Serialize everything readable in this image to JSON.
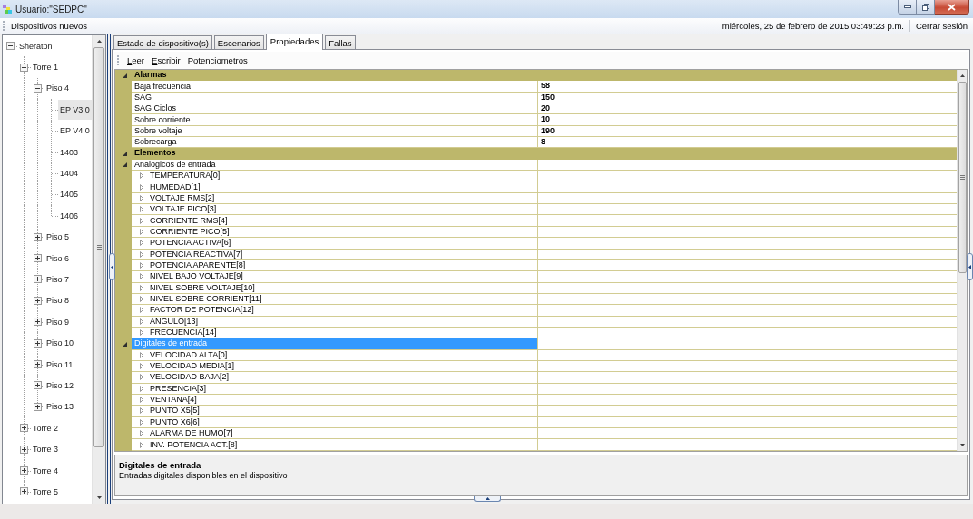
{
  "window": {
    "title": "Usuario:\"SEDPC\""
  },
  "menu_bar": {
    "items": [
      {
        "label": "Dispositivos nuevos"
      }
    ],
    "datetime": "miércoles, 25 de febrero de 2015 03:49:23 p.m.",
    "logout": "Cerrar sesión"
  },
  "tree": [
    {
      "label": "Sheraton",
      "expanded": true,
      "selected": false,
      "children": [
        {
          "label": "Torre 1",
          "expanded": true,
          "selected": false,
          "children": [
            {
              "label": "Piso 4",
              "expanded": true,
              "selected": false,
              "children": [
                {
                  "label": "EP V3.0",
                  "selected": true
                },
                {
                  "label": "EP V4.0",
                  "selected": false
                },
                {
                  "label": "1403",
                  "selected": false
                },
                {
                  "label": "1404",
                  "selected": false
                },
                {
                  "label": "1405",
                  "selected": false
                },
                {
                  "label": "1406",
                  "selected": false
                }
              ]
            },
            {
              "label": "Piso 5",
              "expanded": false,
              "selected": false
            },
            {
              "label": "Piso 6",
              "expanded": false,
              "selected": false
            },
            {
              "label": "Piso 7",
              "expanded": false,
              "selected": false
            },
            {
              "label": "Piso 8",
              "expanded": false,
              "selected": false
            },
            {
              "label": "Piso 9",
              "expanded": false,
              "selected": false
            },
            {
              "label": "Piso 10",
              "expanded": false,
              "selected": false
            },
            {
              "label": "Piso 11",
              "expanded": false,
              "selected": false
            },
            {
              "label": "Piso 12",
              "expanded": false,
              "selected": false
            },
            {
              "label": "Piso 13",
              "expanded": false,
              "selected": false
            }
          ]
        },
        {
          "label": "Torre 2",
          "expanded": false,
          "selected": false
        },
        {
          "label": "Torre 3",
          "expanded": false,
          "selected": false
        },
        {
          "label": "Torre 4",
          "expanded": false,
          "selected": false
        },
        {
          "label": "Torre 5",
          "expanded": false,
          "selected": false
        }
      ]
    }
  ],
  "tabs": [
    {
      "label": "Estado de dispositivo(s)",
      "selected": false
    },
    {
      "label": "Escenarios",
      "selected": false
    },
    {
      "label": "Propiedades",
      "selected": true
    },
    {
      "label": "Fallas",
      "selected": false
    }
  ],
  "toolbar": {
    "buttons": [
      {
        "label": "Leer",
        "mnemonic": true
      },
      {
        "label": "Escribir",
        "mnemonic": true
      },
      {
        "label": "Potenciometros",
        "mnemonic": false
      }
    ]
  },
  "property_grid": {
    "categories": [
      {
        "label": "Alarmas",
        "expanded": true,
        "selected": false,
        "properties": [
          {
            "name": "Baja frecuencia",
            "value": "58",
            "selected": false
          },
          {
            "name": "SAG",
            "value": "150",
            "selected": false
          },
          {
            "name": "SAG Ciclos",
            "value": "20",
            "selected": false
          },
          {
            "name": "Sobre corriente",
            "value": "10",
            "selected": false
          },
          {
            "name": "Sobre voltaje",
            "value": "190",
            "selected": false
          },
          {
            "name": "Sobrecarga",
            "value": "8",
            "selected": false
          }
        ]
      },
      {
        "label": "Elementos",
        "expanded": true,
        "selected": false,
        "properties": [
          {
            "name": "Analogicos de entrada",
            "expanded": true,
            "selected": false,
            "children": [
              {
                "name": "TEMPERATURA[0]",
                "expanded": false,
                "selected": false
              },
              {
                "name": "HUMEDAD[1]",
                "expanded": false,
                "selected": false
              },
              {
                "name": "VOLTAJE RMS[2]",
                "expanded": false,
                "selected": false
              },
              {
                "name": "VOLTAJE PICO[3]",
                "expanded": false,
                "selected": false
              },
              {
                "name": "CORRIENTE RMS[4]",
                "expanded": false,
                "selected": false
              },
              {
                "name": "CORRIENTE PICO[5]",
                "expanded": false,
                "selected": false
              },
              {
                "name": "POTENCIA ACTIVA[6]",
                "expanded": false,
                "selected": false
              },
              {
                "name": "POTENCIA REACTIVA[7]",
                "expanded": false,
                "selected": false
              },
              {
                "name": "POTENCIA APARENTE[8]",
                "expanded": false,
                "selected": false
              },
              {
                "name": "NIVEL BAJO VOLTAJE[9]",
                "expanded": false,
                "selected": false
              },
              {
                "name": "NIVEL SOBRE VOLTAJE[10]",
                "expanded": false,
                "selected": false
              },
              {
                "name": "NIVEL SOBRE CORRIENT[11]",
                "expanded": false,
                "selected": false
              },
              {
                "name": "FACTOR DE POTENCIA[12]",
                "expanded": false,
                "selected": false
              },
              {
                "name": "ANGULO[13]",
                "expanded": false,
                "selected": false
              },
              {
                "name": "FRECUENCIA[14]",
                "expanded": false,
                "selected": false
              }
            ]
          },
          {
            "name": "Digitales de entrada",
            "expanded": true,
            "selected": true,
            "children": [
              {
                "name": "VELOCIDAD ALTA[0]",
                "expanded": false,
                "selected": false
              },
              {
                "name": "VELOCIDAD MEDIA[1]",
                "expanded": false,
                "selected": false
              },
              {
                "name": "VELOCIDAD BAJA[2]",
                "expanded": false,
                "selected": false
              },
              {
                "name": "PRESENCIA[3]",
                "expanded": false,
                "selected": false
              },
              {
                "name": "VENTANA[4]",
                "expanded": false,
                "selected": false
              },
              {
                "name": "PUNTO X5[5]",
                "expanded": false,
                "selected": false
              },
              {
                "name": "PUNTO X6[6]",
                "expanded": false,
                "selected": false
              },
              {
                "name": "ALARMA DE HUMO[7]",
                "expanded": false,
                "selected": false
              },
              {
                "name": "INV. POTENCIA ACT.[8]",
                "expanded": false,
                "selected": false
              }
            ]
          }
        ]
      }
    ]
  },
  "description": {
    "title": "Digitales de entrada",
    "text": "Entradas digitales disponibles en el dispositivo"
  }
}
